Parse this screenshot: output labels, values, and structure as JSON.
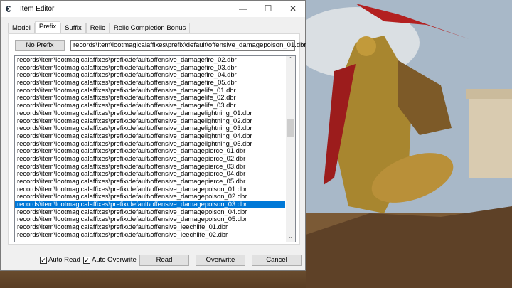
{
  "window": {
    "title": "Item Editor",
    "minimize": "—",
    "maximize": "☐",
    "close": "✕"
  },
  "tabs": [
    {
      "label": "Model"
    },
    {
      "label": "Prefix",
      "active": true
    },
    {
      "label": "Suffix"
    },
    {
      "label": "Relic"
    },
    {
      "label": "Relic Completion Bonus"
    }
  ],
  "prefix": {
    "no_prefix_label": "No Prefix",
    "selected_path": "records\\item\\lootmagicalaffixes\\prefix\\default\\offensive_damagepoison_01.dbr"
  },
  "list": {
    "selected_index": 19,
    "items": [
      "records\\item\\lootmagicalaffixes\\prefix\\default\\offensive_damagefire_02.dbr",
      "records\\item\\lootmagicalaffixes\\prefix\\default\\offensive_damagefire_03.dbr",
      "records\\item\\lootmagicalaffixes\\prefix\\default\\offensive_damagefire_04.dbr",
      "records\\item\\lootmagicalaffixes\\prefix\\default\\offensive_damagefire_05.dbr",
      "records\\item\\lootmagicalaffixes\\prefix\\default\\offensive_damagelife_01.dbr",
      "records\\item\\lootmagicalaffixes\\prefix\\default\\offensive_damagelife_02.dbr",
      "records\\item\\lootmagicalaffixes\\prefix\\default\\offensive_damagelife_03.dbr",
      "records\\item\\lootmagicalaffixes\\prefix\\default\\offensive_damagelightning_01.dbr",
      "records\\item\\lootmagicalaffixes\\prefix\\default\\offensive_damagelightning_02.dbr",
      "records\\item\\lootmagicalaffixes\\prefix\\default\\offensive_damagelightning_03.dbr",
      "records\\item\\lootmagicalaffixes\\prefix\\default\\offensive_damagelightning_04.dbr",
      "records\\item\\lootmagicalaffixes\\prefix\\default\\offensive_damagelightning_05.dbr",
      "records\\item\\lootmagicalaffixes\\prefix\\default\\offensive_damagepierce_01.dbr",
      "records\\item\\lootmagicalaffixes\\prefix\\default\\offensive_damagepierce_02.dbr",
      "records\\item\\lootmagicalaffixes\\prefix\\default\\offensive_damagepierce_03.dbr",
      "records\\item\\lootmagicalaffixes\\prefix\\default\\offensive_damagepierce_04.dbr",
      "records\\item\\lootmagicalaffixes\\prefix\\default\\offensive_damagepierce_05.dbr",
      "records\\item\\lootmagicalaffixes\\prefix\\default\\offensive_damagepoison_01.dbr",
      "records\\item\\lootmagicalaffixes\\prefix\\default\\offensive_damagepoison_02.dbr",
      "records\\item\\lootmagicalaffixes\\prefix\\default\\offensive_damagepoison_03.dbr",
      "records\\item\\lootmagicalaffixes\\prefix\\default\\offensive_damagepoison_04.dbr",
      "records\\item\\lootmagicalaffixes\\prefix\\default\\offensive_damagepoison_05.dbr",
      "records\\item\\lootmagicalaffixes\\prefix\\default\\offensive_leechlife_01.dbr",
      "records\\item\\lootmagicalaffixes\\prefix\\default\\offensive_leechlife_02.dbr"
    ]
  },
  "footer": {
    "auto_read": {
      "label": "Auto Read",
      "checked": true
    },
    "auto_overwrite": {
      "label": "Auto Overwrite",
      "checked": true
    },
    "read": "Read",
    "overwrite": "Overwrite",
    "cancel": "Cancel"
  },
  "colors": {
    "selection": "#0078d7"
  }
}
